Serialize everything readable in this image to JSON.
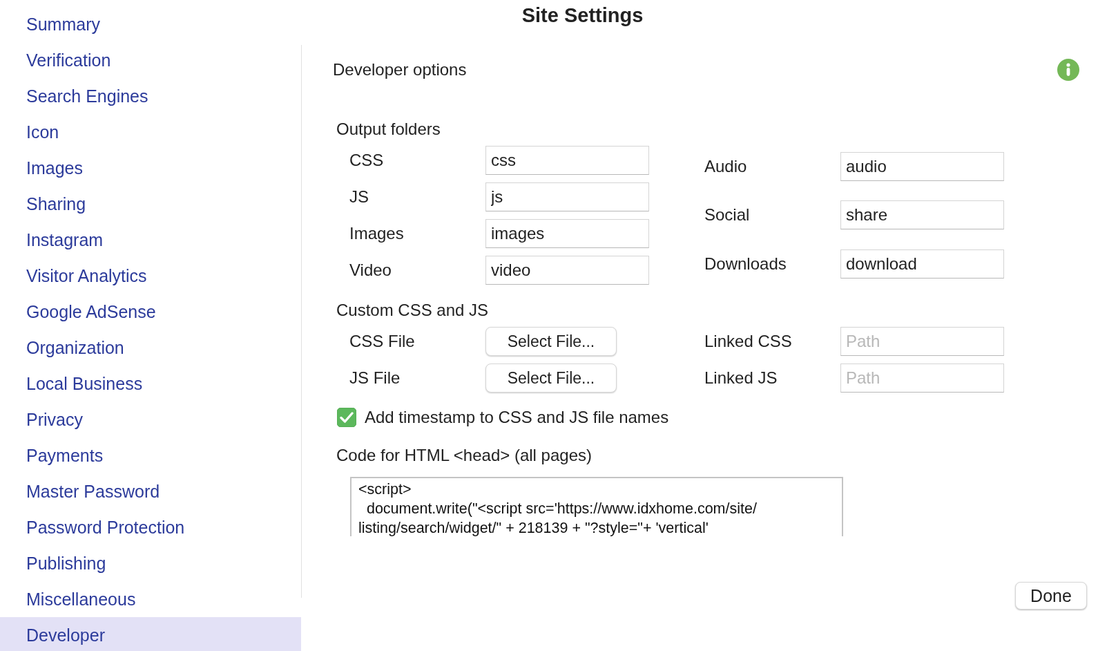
{
  "window": {
    "title": "Site Settings"
  },
  "sidebar": {
    "items": [
      {
        "label": "Summary",
        "selected": false
      },
      {
        "label": "Verification",
        "selected": false
      },
      {
        "label": "Search Engines",
        "selected": false
      },
      {
        "label": "Icon",
        "selected": false
      },
      {
        "label": "Images",
        "selected": false
      },
      {
        "label": "Sharing",
        "selected": false
      },
      {
        "label": "Instagram",
        "selected": false
      },
      {
        "label": "Visitor Analytics",
        "selected": false
      },
      {
        "label": "Google AdSense",
        "selected": false
      },
      {
        "label": "Organization",
        "selected": false
      },
      {
        "label": "Local Business",
        "selected": false
      },
      {
        "label": "Privacy",
        "selected": false
      },
      {
        "label": "Payments",
        "selected": false
      },
      {
        "label": "Master Password",
        "selected": false
      },
      {
        "label": "Password Protection",
        "selected": false
      },
      {
        "label": "Publishing",
        "selected": false
      },
      {
        "label": "Miscellaneous",
        "selected": false
      },
      {
        "label": "Developer",
        "selected": true
      }
    ]
  },
  "section": {
    "heading": "Developer options"
  },
  "output_folders": {
    "heading": "Output folders",
    "left": [
      {
        "label": "CSS",
        "value": "css"
      },
      {
        "label": "JS",
        "value": "js"
      },
      {
        "label": "Images",
        "value": "images"
      },
      {
        "label": "Video",
        "value": "video"
      }
    ],
    "right": [
      {
        "label": "Audio",
        "value": "audio"
      },
      {
        "label": "Social",
        "value": "share"
      },
      {
        "label": "Downloads",
        "value": "download"
      }
    ]
  },
  "custom": {
    "heading": "Custom CSS and JS",
    "files": [
      {
        "label": "CSS File",
        "button": "Select File..."
      },
      {
        "label": "JS File",
        "button": "Select File..."
      }
    ],
    "links": [
      {
        "label": "Linked CSS",
        "placeholder": "Path"
      },
      {
        "label": "Linked JS",
        "placeholder": "Path"
      }
    ]
  },
  "timestamp": {
    "label": "Add timestamp to CSS and JS file names",
    "checked": true
  },
  "head_code": {
    "label": "Code for HTML <head> (all pages)",
    "value": "<script>\n  document.write(\"<script src='https://www.idxhome.com/site/\nlisting/search/widget/\" + 218139 + \"?style=\"+ 'vertical'"
  },
  "done_button": "Done"
}
